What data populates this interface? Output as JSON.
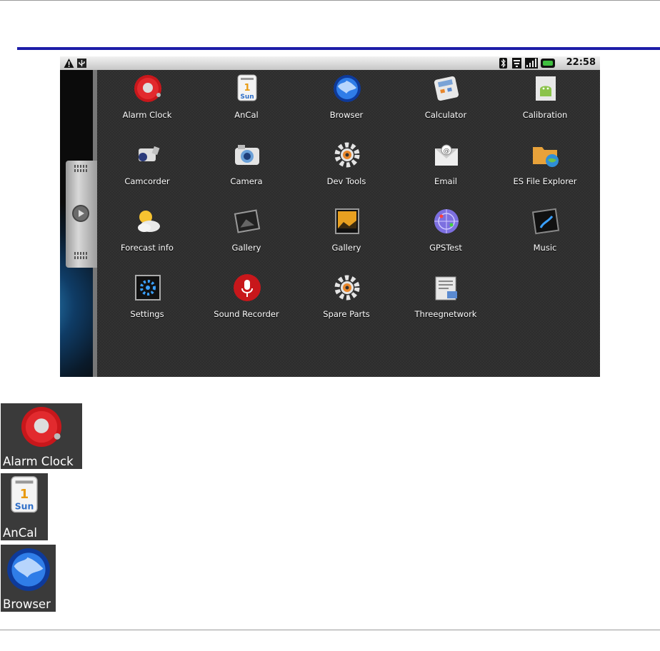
{
  "status_bar": {
    "time": "22:58",
    "left_icons": [
      "warning-icon",
      "usb-icon"
    ],
    "right_icons": [
      "bluetooth-icon",
      "wifi-icon",
      "signal-icon",
      "battery-icon"
    ],
    "battery_color": "#3fbf3f"
  },
  "apps": [
    {
      "label": "Alarm Clock",
      "icon": "alarm-clock-icon"
    },
    {
      "label": "AnCal",
      "icon": "calendar-icon"
    },
    {
      "label": "Browser",
      "icon": "globe-icon"
    },
    {
      "label": "Calculator",
      "icon": "calculator-icon"
    },
    {
      "label": "Calibration",
      "icon": "android-icon"
    },
    {
      "label": "Camcorder",
      "icon": "camcorder-icon"
    },
    {
      "label": "Camera",
      "icon": "camera-icon"
    },
    {
      "label": "Dev Tools",
      "icon": "gear-icon"
    },
    {
      "label": "Email",
      "icon": "email-icon"
    },
    {
      "label": "ES File Explorer",
      "icon": "folder-icon"
    },
    {
      "label": "Forecast info",
      "icon": "weather-icon"
    },
    {
      "label": "Gallery",
      "icon": "gallery-icon"
    },
    {
      "label": "Gallery",
      "icon": "picture-icon"
    },
    {
      "label": "GPSTest",
      "icon": "gps-icon"
    },
    {
      "label": "Music",
      "icon": "music-icon"
    },
    {
      "label": "Settings",
      "icon": "settings-icon"
    },
    {
      "label": "Sound Recorder",
      "icon": "microphone-icon"
    },
    {
      "label": "Spare Parts",
      "icon": "gear-icon"
    },
    {
      "label": "Threegnetwork",
      "icon": "network-icon"
    }
  ],
  "calendar_icon_text": {
    "day": "1",
    "weekday": "Sun"
  },
  "zoom_examples": [
    {
      "label": "Alarm Clock",
      "icon": "alarm-clock-icon"
    },
    {
      "label": "AnCal",
      "icon": "calendar-icon"
    },
    {
      "label": "Browser",
      "icon": "globe-icon"
    }
  ],
  "colors": {
    "header_rule": "#1d1da8",
    "screen_bg": "#2c2c2c"
  }
}
